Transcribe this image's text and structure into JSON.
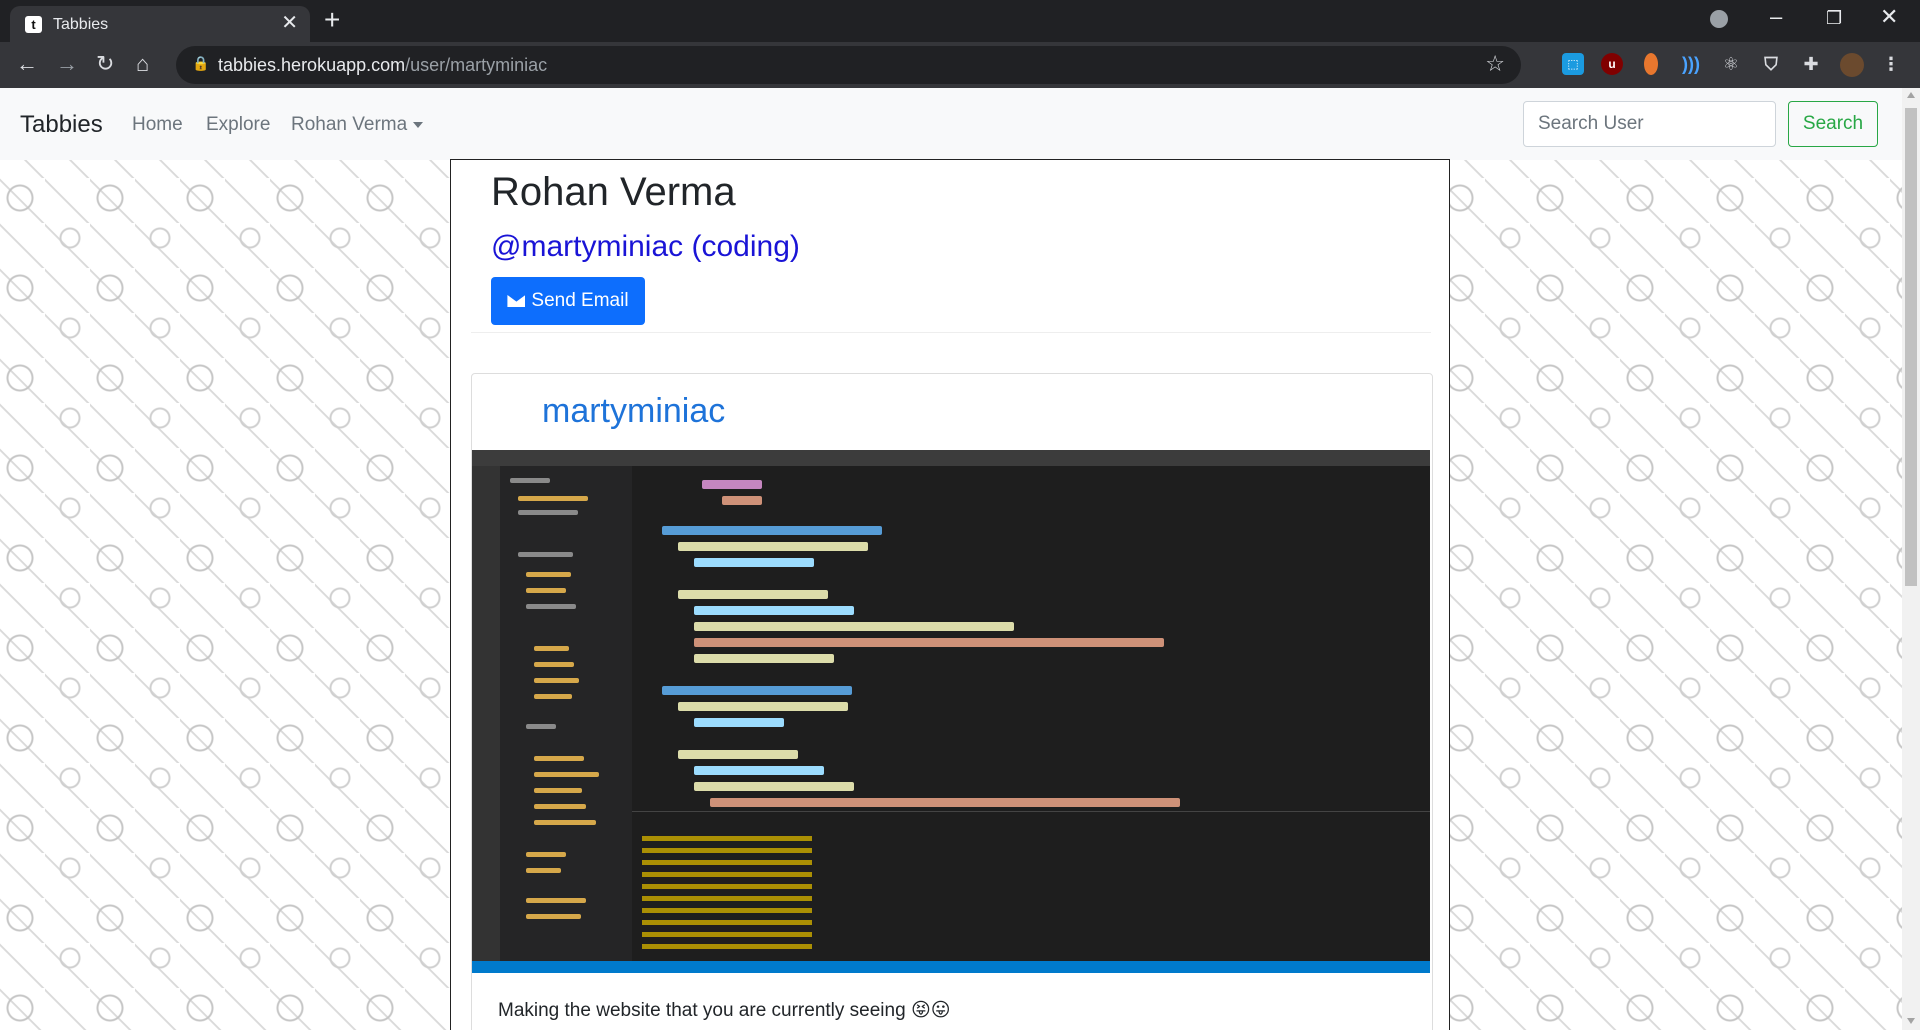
{
  "browser": {
    "tab_title": "Tabbies",
    "tab_favicon": "t",
    "url_host": "tabbies.herokuapp.com",
    "url_path": "/user/martyminiac",
    "extension_icons": [
      "bitwarden-icon",
      "ublock-icon",
      "cookie-icon",
      "wave-icon",
      "react-devtools-icon",
      "brave-shield-icon",
      "puzzle-icon",
      "profile-avatar"
    ]
  },
  "navbar": {
    "brand": "Tabbies",
    "links": [
      "Home",
      "Explore",
      "Rohan Verma"
    ],
    "search_placeholder": "Search User",
    "search_button": "Search"
  },
  "profile": {
    "name": "Rohan Verma",
    "handle": "@martyminiac (coding)",
    "email_button": "Send Email"
  },
  "post": {
    "username": "martyminiac",
    "image_description": "screenshot",
    "caption": "Making the website that you are currently seeing 😝😛"
  }
}
